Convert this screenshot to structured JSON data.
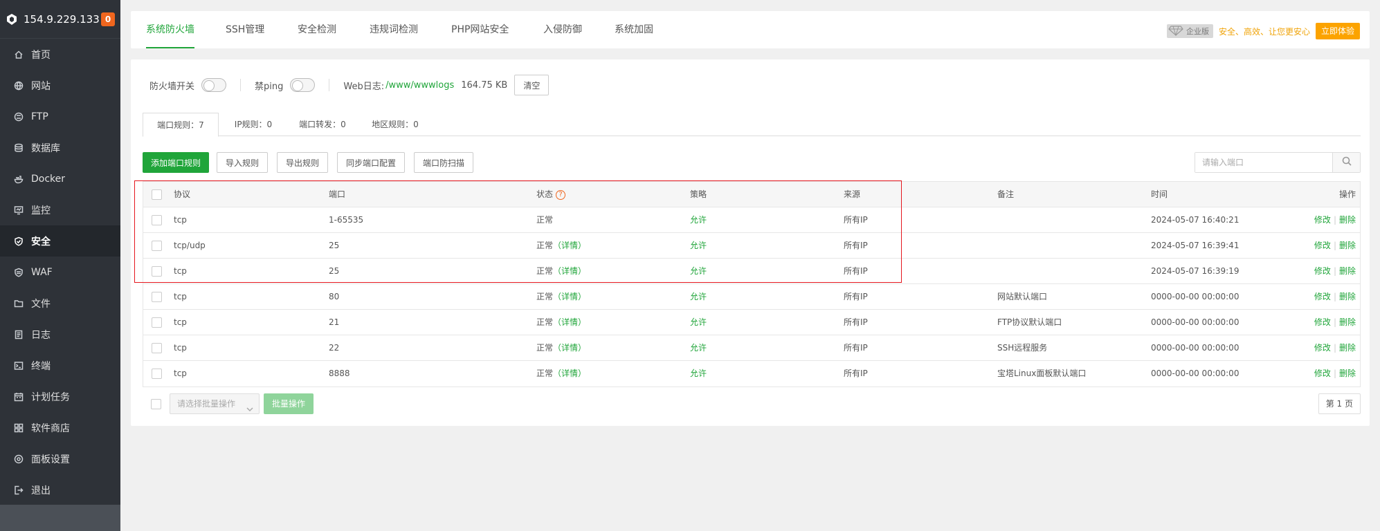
{
  "sidebar": {
    "server_ip": "154.9.229.133",
    "badge_count": "0",
    "items": [
      {
        "label": "首页",
        "icon": "home-icon"
      },
      {
        "label": "网站",
        "icon": "globe-icon"
      },
      {
        "label": "FTP",
        "icon": "ftp-icon"
      },
      {
        "label": "数据库",
        "icon": "database-icon"
      },
      {
        "label": "Docker",
        "icon": "docker-icon"
      },
      {
        "label": "监控",
        "icon": "monitor-icon"
      },
      {
        "label": "安全",
        "icon": "shield-icon",
        "active": true
      },
      {
        "label": "WAF",
        "icon": "waf-icon"
      },
      {
        "label": "文件",
        "icon": "folder-icon"
      },
      {
        "label": "日志",
        "icon": "log-icon"
      },
      {
        "label": "终端",
        "icon": "terminal-icon"
      },
      {
        "label": "计划任务",
        "icon": "calendar-icon"
      },
      {
        "label": "软件商店",
        "icon": "grid-icon"
      },
      {
        "label": "面板设置",
        "icon": "gear-icon"
      },
      {
        "label": "退出",
        "icon": "logout-icon"
      }
    ]
  },
  "top_tabs": [
    "系统防火墙",
    "SSH管理",
    "安全检测",
    "违规词检测",
    "PHP网站安全",
    "入侵防御",
    "系统加固"
  ],
  "promo": {
    "edition": "企业版",
    "slogan": "安全、高效、让您更安心",
    "button": "立即体验"
  },
  "toolbar": {
    "firewall_label": "防火墙开关",
    "ping_label": "禁ping",
    "weblog_label": "Web日志:",
    "weblog_path": "/www/wwwlogs",
    "weblog_size": "164.75 KB",
    "clear_button": "清空"
  },
  "sub_tabs": [
    "端口规则：7",
    "IP规则：0",
    "端口转发：0",
    "地区规则：0"
  ],
  "actions": {
    "add": "添加端口规则",
    "import": "导入规则",
    "export": "导出规则",
    "sync": "同步端口配置",
    "scan": "端口防扫描",
    "search_placeholder": "请输入端口"
  },
  "table": {
    "headers": {
      "protocol": "协议",
      "port": "端口",
      "status": "状态",
      "policy": "策略",
      "source": "来源",
      "remark": "备注",
      "time": "时间",
      "ops": "操作"
    },
    "edit_label": "修改",
    "delete_label": "删除",
    "sep": "|",
    "rows": [
      {
        "protocol": "tcp",
        "port": "1-65535",
        "status": "正常",
        "detail": "",
        "policy": "允许",
        "source": "所有IP",
        "remark": "",
        "time": "2024-05-07 16:40:21"
      },
      {
        "protocol": "tcp/udp",
        "port": "25",
        "status": "正常",
        "detail": "（详情）",
        "policy": "允许",
        "source": "所有IP",
        "remark": "",
        "time": "2024-05-07 16:39:41"
      },
      {
        "protocol": "tcp",
        "port": "25",
        "status": "正常",
        "detail": "（详情）",
        "policy": "允许",
        "source": "所有IP",
        "remark": "",
        "time": "2024-05-07 16:39:19"
      },
      {
        "protocol": "tcp",
        "port": "80",
        "status": "正常",
        "detail": "（详情）",
        "policy": "允许",
        "source": "所有IP",
        "remark": "网站默认端口",
        "time": "0000-00-00 00:00:00"
      },
      {
        "protocol": "tcp",
        "port": "21",
        "status": "正常",
        "detail": "（详情）",
        "policy": "允许",
        "source": "所有IP",
        "remark": "FTP协议默认端口",
        "time": "0000-00-00 00:00:00"
      },
      {
        "protocol": "tcp",
        "port": "22",
        "status": "正常",
        "detail": "（详情）",
        "policy": "允许",
        "source": "所有IP",
        "remark": "SSH远程服务",
        "time": "0000-00-00 00:00:00"
      },
      {
        "protocol": "tcp",
        "port": "8888",
        "status": "正常",
        "detail": "（详情）",
        "policy": "允许",
        "source": "所有IP",
        "remark": "宝塔Linux面板默认端口",
        "time": "0000-00-00 00:00:00"
      }
    ]
  },
  "bottom": {
    "batch_select_placeholder": "请选择批量操作",
    "batch_button": "批量操作",
    "pager": "第 1 页"
  },
  "colors": {
    "accent": "#20a53a",
    "sidebar_bg": "#2e3238",
    "highlight": "#e5151c",
    "promo": "#fca300"
  }
}
